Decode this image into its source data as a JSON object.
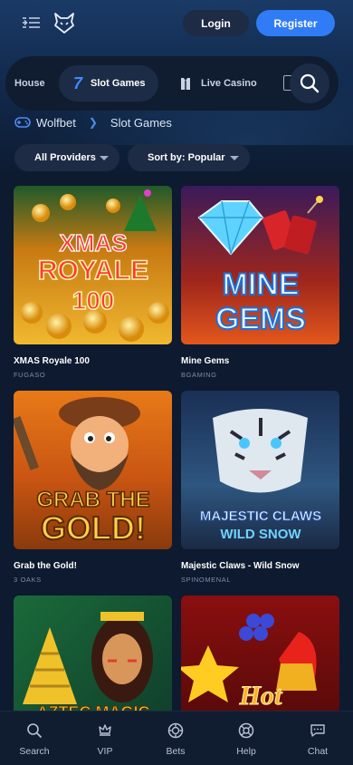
{
  "header": {
    "login_label": "Login",
    "register_label": "Register"
  },
  "categories": {
    "house_label": "House",
    "slot_number": "7",
    "slot_label": "Slot Games",
    "live_label": "Live Casino"
  },
  "breadcrumb": {
    "root": "Wolfbet",
    "current": "Slot Games"
  },
  "filters": {
    "providers_label": "All Providers",
    "sort_label": "Sort by: Popular"
  },
  "games": [
    {
      "title": "XMAS Royale 100",
      "provider": "FUGASO",
      "art_line1": "XMAS",
      "art_line2": "ROYALE",
      "art_line3": "100"
    },
    {
      "title": "Mine Gems",
      "provider": "BGAMING",
      "art_line1": "MINE",
      "art_line2": "GEMS"
    },
    {
      "title": "Grab the Gold!",
      "provider": "3 OAKS",
      "art_line1": "GRAB THE",
      "art_line2": "GOLD!"
    },
    {
      "title": "Majestic Claws - Wild Snow",
      "provider": "SPINOMENAL",
      "art_line1": "MAJESTIC CLAWS",
      "art_line2": "WILD SNOW"
    },
    {
      "title": "",
      "provider": "",
      "art_line1": "AZTEC MAGIC"
    },
    {
      "title": "",
      "provider": "",
      "art_line1": "Hot"
    }
  ],
  "bottom_nav": [
    {
      "label": "Search",
      "icon": "search-icon"
    },
    {
      "label": "VIP",
      "icon": "crown-icon"
    },
    {
      "label": "Bets",
      "icon": "chip-icon"
    },
    {
      "label": "Help",
      "icon": "lifebuoy-icon"
    },
    {
      "label": "Chat",
      "icon": "chat-icon"
    }
  ],
  "colors": {
    "accent": "#2f7cf6",
    "background": "#0d1a2f",
    "panel": "#1d2b44"
  }
}
